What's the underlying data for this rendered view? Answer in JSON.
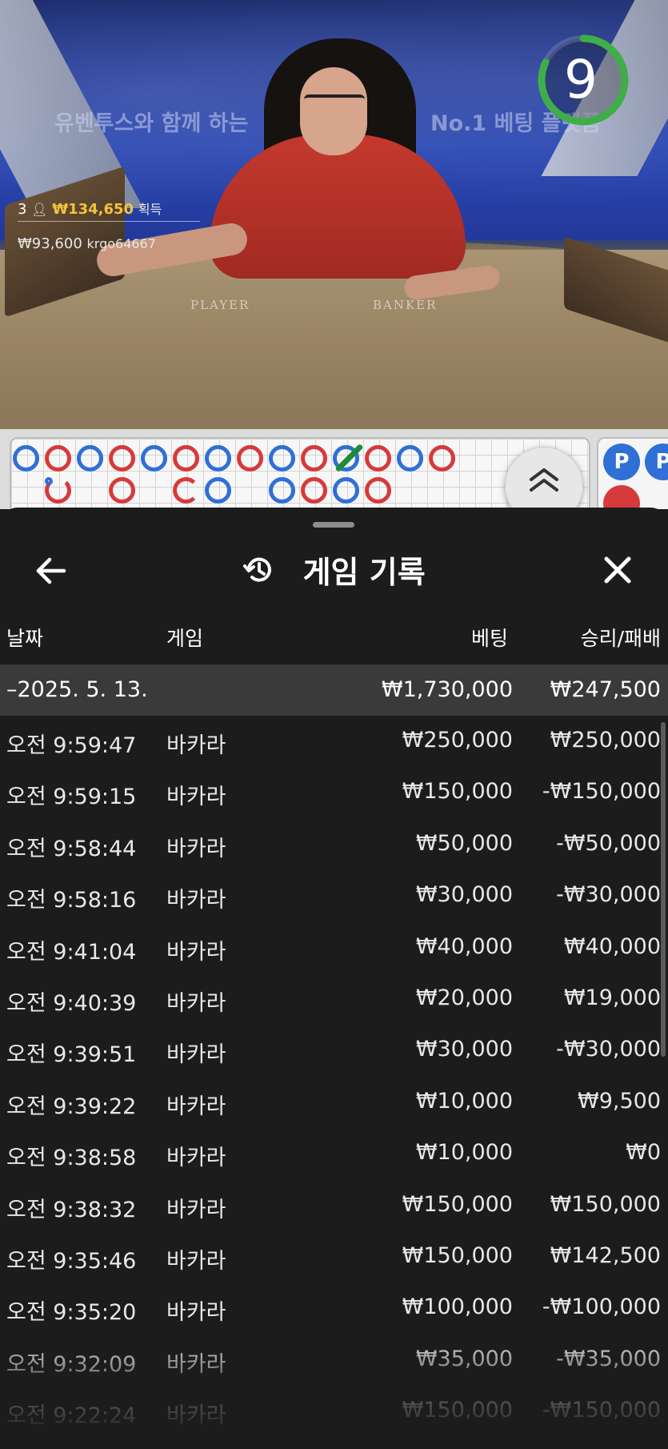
{
  "video": {
    "banner_left": "유벤투스와 함께 하는",
    "banner_right": "No.1 베팅 플랫폼",
    "table_player": "PLAYER",
    "table_banker": "BANKER",
    "winners_count": "3",
    "winners_amount": "₩134,650",
    "winners_suffix": "획득",
    "top_winner_amount": "₩93,600",
    "top_winner_user": "krgo64667",
    "timer": "9",
    "timer_progress": 0.82,
    "colors": {
      "timer": "#3fae49",
      "gold": "#f3c33b"
    }
  },
  "roadmap": {
    "side_chips": [
      "P",
      "P"
    ],
    "expand_icon": "double-chevron-up-icon",
    "colors": {
      "player": "#2f6fd6",
      "banker": "#d63a3a",
      "tie": "#1e8a3a"
    }
  },
  "sheet": {
    "title": "게임 기록",
    "title_icon": "history-icon",
    "back_icon": "arrow-left-icon",
    "close_icon": "close-icon",
    "columns": {
      "date": "날짜",
      "game": "게임",
      "bet": "베팅",
      "winloss": "승리/패배"
    },
    "summary": {
      "date": "–2025. 5. 13.",
      "bet": "₩1,730,000",
      "winloss": "₩247,500"
    },
    "rows": [
      {
        "time": "오전 9:59:47",
        "game": "바카라",
        "bet": "₩250,000",
        "winloss": "₩250,000"
      },
      {
        "time": "오전 9:59:15",
        "game": "바카라",
        "bet": "₩150,000",
        "winloss": "-₩150,000"
      },
      {
        "time": "오전 9:58:44",
        "game": "바카라",
        "bet": "₩50,000",
        "winloss": "-₩50,000"
      },
      {
        "time": "오전 9:58:16",
        "game": "바카라",
        "bet": "₩30,000",
        "winloss": "-₩30,000"
      },
      {
        "time": "오전 9:41:04",
        "game": "바카라",
        "bet": "₩40,000",
        "winloss": "₩40,000"
      },
      {
        "time": "오전 9:40:39",
        "game": "바카라",
        "bet": "₩20,000",
        "winloss": "₩19,000"
      },
      {
        "time": "오전 9:39:51",
        "game": "바카라",
        "bet": "₩30,000",
        "winloss": "-₩30,000"
      },
      {
        "time": "오전 9:39:22",
        "game": "바카라",
        "bet": "₩10,000",
        "winloss": "₩9,500"
      },
      {
        "time": "오전 9:38:58",
        "game": "바카라",
        "bet": "₩10,000",
        "winloss": "₩0"
      },
      {
        "time": "오전 9:38:32",
        "game": "바카라",
        "bet": "₩150,000",
        "winloss": "₩150,000"
      },
      {
        "time": "오전 9:35:46",
        "game": "바카라",
        "bet": "₩150,000",
        "winloss": "₩142,500"
      },
      {
        "time": "오전 9:35:20",
        "game": "바카라",
        "bet": "₩100,000",
        "winloss": "-₩100,000"
      },
      {
        "time": "오전 9:32:09",
        "game": "바카라",
        "bet": "₩35,000",
        "winloss": "-₩35,000"
      },
      {
        "time": "오전 9:22:24",
        "game": "바카라",
        "bet": "₩150,000",
        "winloss": "-₩150,000"
      }
    ]
  }
}
